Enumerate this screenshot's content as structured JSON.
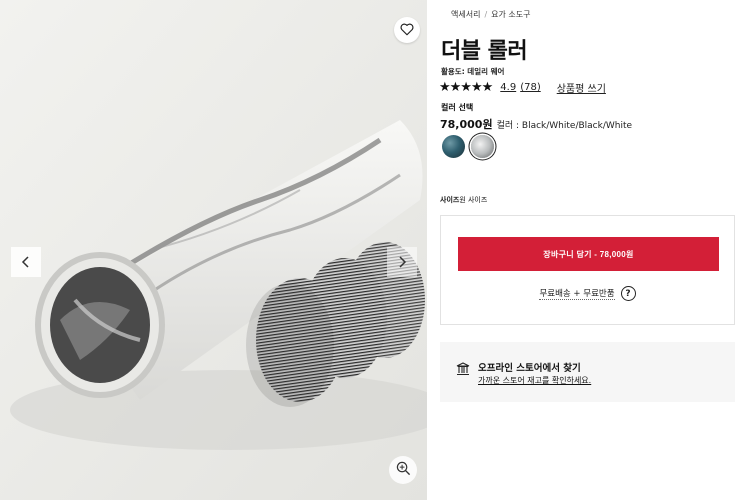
{
  "breadcrumb": {
    "items": [
      "액세서리",
      "요가 소도구"
    ]
  },
  "product": {
    "title": "더블 롤러",
    "activity": "활용도: 데일리 웨어",
    "rating": "4.9",
    "review_count": "(78)",
    "write_review": "상품평 쓰기",
    "stars": "★★★★★",
    "color_label": "컬러 선택",
    "price": "78,000원",
    "color_name": "컬러 : Black/White/Black/White",
    "swatches": [
      {
        "name": "Teal/Black",
        "color": "#2f5f6f"
      },
      {
        "name": "Black/White/Black/White",
        "color": "#b9bcbd",
        "selected": true
      }
    ],
    "size_label_bold": "사이즈",
    "size_label_rest": "원 사이즈"
  },
  "cart": {
    "add_to_cart": "장바구니 담기 - 78,000원",
    "shipping": "무료배송 + 무료반품",
    "help_symbol": "?"
  },
  "store": {
    "title": "오프라인 스토어에서 찾기",
    "subtitle": "가까운 스토어 재고를 확인하세요."
  },
  "gallery": {
    "prev_symbol": "‹",
    "next_symbol": "›"
  },
  "colors": {
    "accent": "#d31f37",
    "image_background": "#ecece9"
  },
  "icons": {
    "wishlist": "heart-icon",
    "zoom": "zoom-in-icon",
    "store": "store-building-icon"
  }
}
